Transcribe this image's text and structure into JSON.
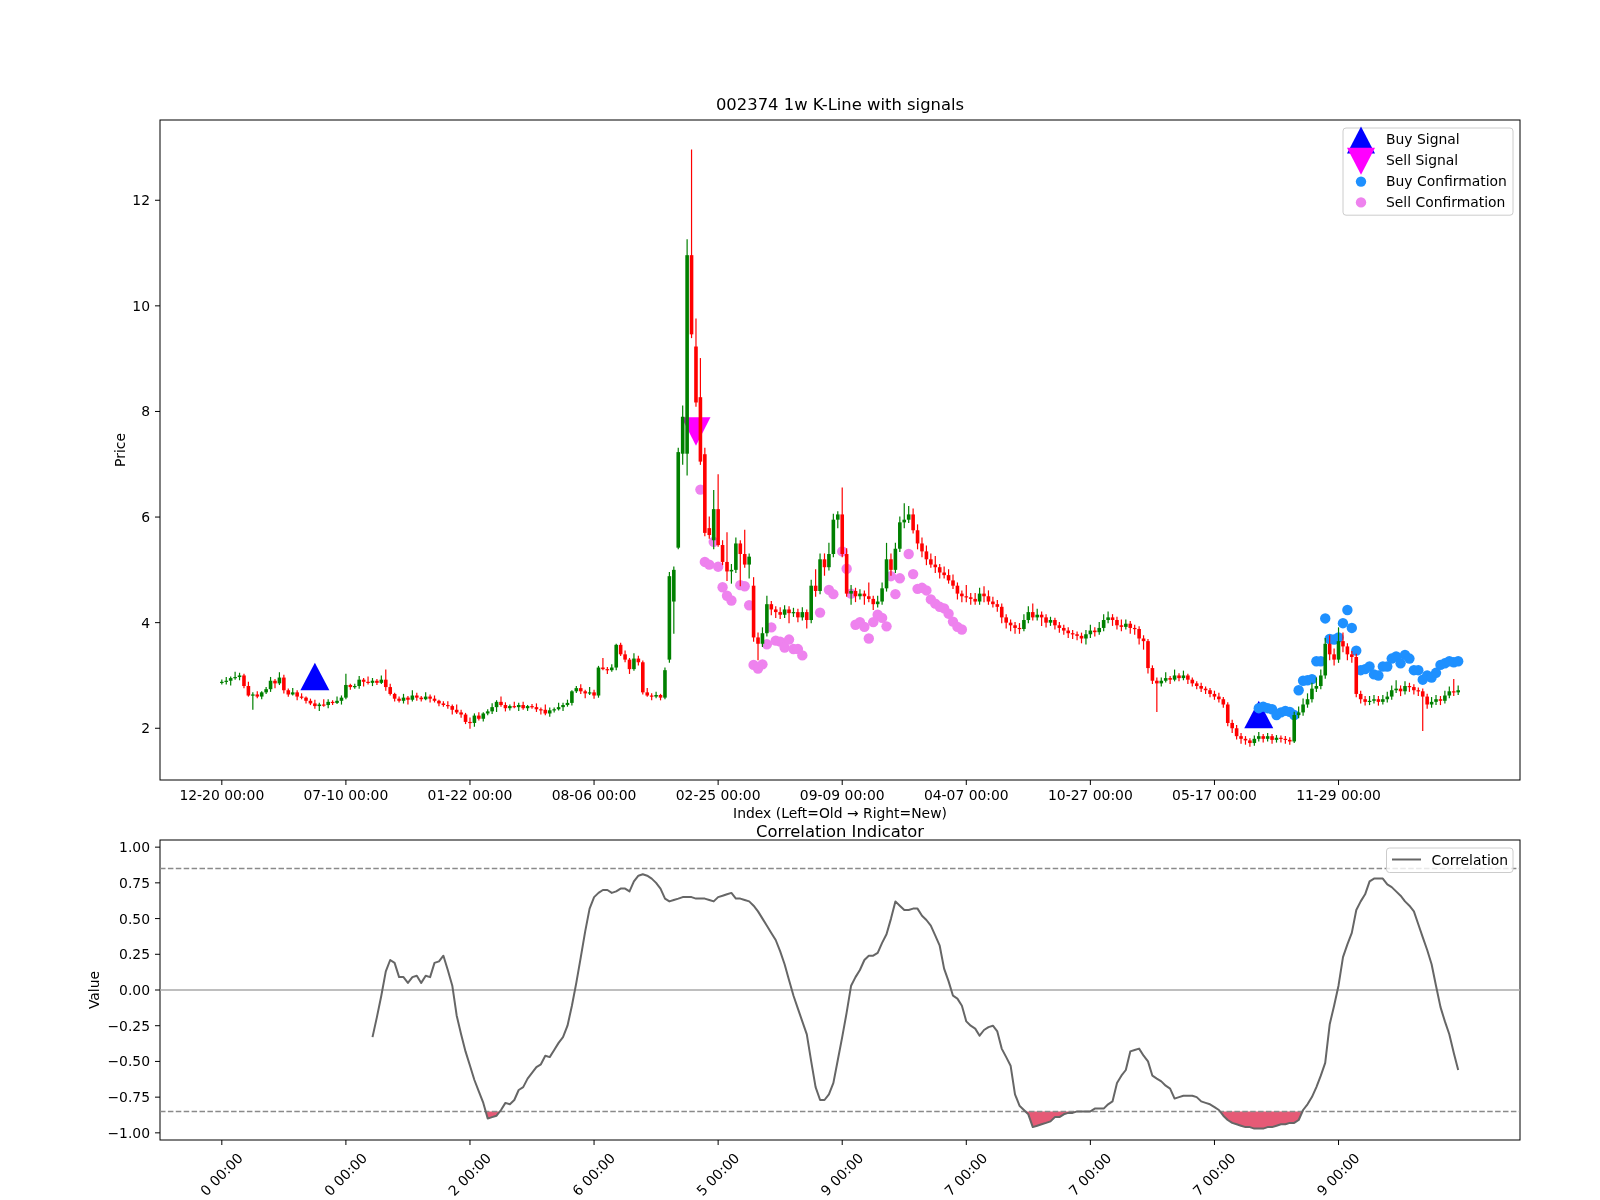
{
  "price_chart": {
    "chart_data": {
      "type": "candlestick",
      "title": "002374 1w K-Line with signals",
      "xlabel": "Index (Left=Old → Right=New)",
      "ylabel": "Price",
      "categories": [
        "12-20 00:00",
        null,
        null,
        null,
        null,
        null,
        null,
        null,
        null,
        null,
        null,
        null,
        null,
        null,
        null,
        null,
        null,
        null,
        null,
        null,
        null,
        null,
        null,
        null,
        null,
        null,
        null,
        null,
        "07-10 00:00",
        null,
        null,
        null,
        null,
        null,
        null,
        null,
        null,
        null,
        null,
        null,
        null,
        null,
        null,
        null,
        null,
        null,
        null,
        null,
        null,
        null,
        null,
        null,
        null,
        null,
        null,
        null,
        "01-22 00:00",
        null,
        null,
        null,
        null,
        null,
        null,
        null,
        null,
        null,
        null,
        null,
        null,
        null,
        null,
        null,
        null,
        null,
        null,
        null,
        null,
        null,
        null,
        null,
        null,
        null,
        null,
        null,
        "08-06 00:00",
        null,
        null,
        null,
        null,
        null,
        null,
        null,
        null,
        null,
        null,
        null,
        null,
        null,
        null,
        null,
        null,
        null,
        null,
        null,
        null,
        null,
        null,
        null,
        null,
        null,
        null,
        null,
        "02-25 00:00",
        null,
        null,
        null,
        null,
        null,
        null,
        null,
        null,
        null,
        null,
        null,
        null,
        null,
        null,
        null,
        null,
        null,
        null,
        null,
        null,
        null,
        null,
        null,
        null,
        null,
        null,
        null,
        "09-09 00:00",
        null,
        null,
        null,
        null,
        null,
        null,
        null,
        null,
        null,
        null,
        null,
        null,
        null,
        null,
        null,
        null,
        null,
        null,
        null,
        null,
        null,
        null,
        null,
        null,
        null,
        null,
        null,
        "04-07 00:00",
        null,
        null,
        null,
        null,
        null,
        null,
        null,
        null,
        null,
        null,
        null,
        null,
        null,
        null,
        null,
        null,
        null,
        null,
        null,
        null,
        null,
        null,
        null,
        null,
        null,
        null,
        null,
        "10-27 00:00",
        null,
        null,
        null,
        null,
        null,
        null,
        null,
        null,
        null,
        null,
        null,
        null,
        null,
        null,
        null,
        null,
        null,
        null,
        null,
        null,
        null,
        null,
        null,
        null,
        null,
        null,
        null,
        "05-17 00:00",
        null,
        null,
        null,
        null,
        null,
        null,
        null,
        null,
        null,
        null,
        null,
        null,
        null,
        null,
        null,
        null,
        null,
        null,
        null,
        null,
        null,
        null,
        null,
        null,
        null,
        null,
        null,
        "11-29 00:00",
        null,
        null,
        null,
        null,
        null,
        null,
        null,
        null,
        null,
        null,
        null,
        null,
        null,
        null,
        null,
        null,
        null,
        null,
        null,
        null,
        null,
        null,
        null,
        null,
        null,
        null,
        null
      ],
      "ohlc": [
        [
          2.86,
          2.91,
          2.84,
          2.88
        ],
        [
          2.88,
          2.96,
          2.84,
          2.9
        ],
        [
          2.9,
          2.97,
          2.82,
          2.95
        ],
        [
          2.95,
          3.06,
          2.93,
          2.97
        ],
        [
          2.97,
          3.04,
          2.92,
          3
        ],
        [
          3,
          3.02,
          2.77,
          2.8
        ],
        [
          2.8,
          2.87,
          2.61,
          2.62
        ],
        [
          2.62,
          2.67,
          2.36,
          2.64
        ],
        [
          2.64,
          2.69,
          2.58,
          2.6
        ],
        [
          2.6,
          2.69,
          2.56,
          2.68
        ],
        [
          2.68,
          2.77,
          2.66,
          2.74
        ],
        [
          2.74,
          2.96,
          2.7,
          2.9
        ],
        [
          2.9,
          2.92,
          2.77,
          2.85
        ],
        [
          2.85,
          3.05,
          2.83,
          2.96
        ],
        [
          2.96,
          3,
          2.67,
          2.72
        ],
        [
          2.72,
          2.74,
          2.61,
          2.64
        ],
        [
          2.64,
          2.75,
          2.63,
          2.68
        ],
        [
          2.68,
          2.71,
          2.54,
          2.6
        ],
        [
          2.6,
          2.65,
          2.56,
          2.58
        ],
        [
          2.58,
          2.59,
          2.48,
          2.52
        ],
        [
          2.52,
          2.55,
          2.45,
          2.47
        ],
        [
          2.47,
          2.53,
          2.38,
          2.42
        ],
        [
          2.42,
          2.47,
          2.34,
          2.45
        ],
        [
          2.45,
          2.54,
          2.42,
          2.44
        ],
        [
          2.44,
          2.54,
          2.39,
          2.5
        ],
        [
          2.5,
          2.52,
          2.45,
          2.48
        ],
        [
          2.48,
          2.59,
          2.47,
          2.52
        ],
        [
          2.52,
          2.61,
          2.46,
          2.58
        ],
        [
          2.58,
          3.02,
          2.56,
          2.82
        ],
        [
          2.82,
          2.83,
          2.74,
          2.78
        ],
        [
          2.78,
          2.83,
          2.76,
          2.8
        ],
        [
          2.8,
          2.98,
          2.76,
          2.92
        ],
        [
          2.92,
          2.94,
          2.8,
          2.88
        ],
        [
          2.88,
          2.97,
          2.84,
          2.86
        ],
        [
          2.86,
          2.94,
          2.81,
          2.9
        ],
        [
          2.9,
          2.92,
          2.83,
          2.86
        ],
        [
          2.86,
          2.99,
          2.85,
          2.92
        ],
        [
          2.92,
          3.1,
          2.72,
          2.78
        ],
        [
          2.78,
          2.83,
          2.63,
          2.65
        ],
        [
          2.65,
          2.66,
          2.52,
          2.56
        ],
        [
          2.56,
          2.59,
          2.5,
          2.52
        ],
        [
          2.52,
          2.64,
          2.48,
          2.58
        ],
        [
          2.58,
          2.6,
          2.46,
          2.54
        ],
        [
          2.54,
          2.71,
          2.52,
          2.62
        ],
        [
          2.62,
          2.66,
          2.53,
          2.58
        ],
        [
          2.58,
          2.6,
          2.52,
          2.55
        ],
        [
          2.55,
          2.67,
          2.54,
          2.6
        ],
        [
          2.6,
          2.63,
          2.5,
          2.56
        ],
        [
          2.56,
          2.61,
          2.5,
          2.52
        ],
        [
          2.52,
          2.53,
          2.43,
          2.47
        ],
        [
          2.47,
          2.5,
          2.42,
          2.44
        ],
        [
          2.44,
          2.5,
          2.38,
          2.42
        ],
        [
          2.42,
          2.44,
          2.27,
          2.35
        ],
        [
          2.35,
          2.44,
          2.28,
          2.3
        ],
        [
          2.3,
          2.34,
          2.21,
          2.26
        ],
        [
          2.26,
          2.28,
          2.09,
          2.12
        ],
        [
          2.12,
          2.19,
          2,
          2.1
        ],
        [
          2.1,
          2.27,
          2.04,
          2.24
        ],
        [
          2.24,
          2.29,
          2.16,
          2.18
        ],
        [
          2.18,
          2.29,
          2.14,
          2.28
        ],
        [
          2.28,
          2.35,
          2.26,
          2.32
        ],
        [
          2.32,
          2.46,
          2.28,
          2.4
        ],
        [
          2.4,
          2.52,
          2.32,
          2.5
        ],
        [
          2.5,
          2.59,
          2.42,
          2.44
        ],
        [
          2.44,
          2.48,
          2.33,
          2.38
        ],
        [
          2.38,
          2.44,
          2.35,
          2.42
        ],
        [
          2.42,
          2.49,
          2.39,
          2.4
        ],
        [
          2.4,
          2.47,
          2.34,
          2.44
        ],
        [
          2.44,
          2.49,
          2.36,
          2.38
        ],
        [
          2.38,
          2.43,
          2.34,
          2.42
        ],
        [
          2.42,
          2.45,
          2.38,
          2.4
        ],
        [
          2.4,
          2.46,
          2.32,
          2.36
        ],
        [
          2.36,
          2.38,
          2.27,
          2.35
        ],
        [
          2.35,
          2.44,
          2.26,
          2.28
        ],
        [
          2.28,
          2.38,
          2.23,
          2.34
        ],
        [
          2.34,
          2.38,
          2.31,
          2.36
        ],
        [
          2.36,
          2.47,
          2.35,
          2.4
        ],
        [
          2.4,
          2.47,
          2.34,
          2.44
        ],
        [
          2.44,
          2.53,
          2.42,
          2.48
        ],
        [
          2.48,
          2.71,
          2.44,
          2.7
        ],
        [
          2.7,
          2.79,
          2.68,
          2.76
        ],
        [
          2.76,
          2.82,
          2.66,
          2.7
        ],
        [
          2.7,
          2.72,
          2.58,
          2.66
        ],
        [
          2.66,
          2.77,
          2.64,
          2.68
        ],
        [
          2.68,
          2.72,
          2.57,
          2.62
        ],
        [
          2.62,
          3.17,
          2.59,
          3.15
        ],
        [
          3.15,
          3.32,
          3.11,
          3.12
        ],
        [
          3.12,
          3.15,
          3.04,
          3.1
        ],
        [
          3.1,
          3.2,
          3.08,
          3.15
        ],
        [
          3.15,
          3.59,
          3.11,
          3.58
        ],
        [
          3.58,
          3.61,
          3.38,
          3.4
        ],
        [
          3.4,
          3.46,
          3.26,
          3.3
        ],
        [
          3.3,
          3.32,
          3.04,
          3.12
        ],
        [
          3.12,
          3.41,
          3.1,
          3.32
        ],
        [
          3.32,
          3.36,
          3.2,
          3.25
        ],
        [
          3.25,
          3.27,
          2.65,
          2.68
        ],
        [
          2.68,
          2.75,
          2.61,
          2.62
        ],
        [
          2.62,
          2.65,
          2.54,
          2.6
        ],
        [
          2.6,
          2.68,
          2.58,
          2.63
        ],
        [
          2.63,
          2.64,
          2.54,
          2.58
        ],
        [
          2.58,
          3.14,
          2.56,
          3.1
        ],
        [
          3.3,
          4.95,
          3.25,
          4.88
        ],
        [
          4.4,
          5.05,
          3.8,
          5
        ],
        [
          5.42,
          7.3,
          5.4,
          7.23
        ],
        [
          7.2,
          8.1,
          7,
          7.9
        ],
        [
          7.2,
          11.25,
          6.8,
          10.96
        ],
        [
          10.96,
          12.95,
          9.4,
          9.46
        ],
        [
          9.23,
          9.75,
          8.1,
          8.17
        ],
        [
          8.27,
          9,
          7,
          7.05
        ],
        [
          7.19,
          7.3,
          5.65,
          5.7
        ],
        [
          5.79,
          6,
          5.6,
          5.66
        ],
        [
          5.56,
          6.5,
          5.4,
          6.15
        ],
        [
          6.15,
          6.8,
          5.45,
          5.47
        ],
        [
          5.47,
          5.55,
          5.1,
          5.15
        ],
        [
          5.15,
          5.7,
          4.8,
          4.97
        ],
        [
          4.97,
          5.1,
          4.75,
          5
        ],
        [
          5,
          5.6,
          4.95,
          5.5
        ],
        [
          5.5,
          5.55,
          4.7,
          5.3
        ],
        [
          5.3,
          5.75,
          5.05,
          5.1
        ],
        [
          5.1,
          5.3,
          4.85,
          5.25
        ],
        [
          4.7,
          4.85,
          3.65,
          3.72
        ],
        [
          3.72,
          3.8,
          3.3,
          3.6
        ],
        [
          3.6,
          3.9,
          3.55,
          3.8
        ],
        [
          3.8,
          4.5,
          3.75,
          4.35
        ],
        [
          4.35,
          4.4,
          4.15,
          4.25
        ],
        [
          4.25,
          4.3,
          4.1,
          4.2
        ],
        [
          4.2,
          4.28,
          4.08,
          4.15
        ],
        [
          4.15,
          4.32,
          4.1,
          4.25
        ],
        [
          4.25,
          4.3,
          4,
          4.18
        ],
        [
          4.18,
          4.27,
          4.12,
          4.2
        ],
        [
          4.2,
          4.25,
          4.02,
          4.1
        ],
        [
          4.1,
          4.28,
          4.05,
          4.2
        ],
        [
          4.2,
          4.24,
          3.9,
          4.05
        ],
        [
          4.05,
          4.8,
          4,
          4.7
        ],
        [
          4.7,
          5,
          4.5,
          4.6
        ],
        [
          4.6,
          5.3,
          4.55,
          5.2
        ],
        [
          5.2,
          5.3,
          4.9,
          5.05
        ],
        [
          5.05,
          5.5,
          5,
          5.3
        ],
        [
          5.3,
          6.05,
          5.25,
          5.95
        ],
        [
          5.95,
          6.1,
          5.8,
          6.05
        ],
        [
          6.05,
          6.55,
          5.25,
          5.3
        ],
        [
          5.3,
          5.4,
          4.5,
          4.55
        ],
        [
          4.55,
          4.7,
          4.35,
          4.6
        ],
        [
          4.6,
          4.65,
          4.4,
          4.5
        ],
        [
          4.5,
          4.62,
          4.45,
          4.55
        ],
        [
          4.55,
          4.6,
          4.35,
          4.5
        ],
        [
          4.5,
          4.75,
          4.4,
          4.45
        ],
        [
          4.45,
          4.5,
          4.25,
          4.35
        ],
        [
          4.35,
          4.5,
          4.3,
          4.4
        ],
        [
          4.4,
          4.75,
          4.35,
          4.65
        ],
        [
          4.65,
          5.5,
          4.6,
          5.2
        ],
        [
          5.2,
          5.3,
          4.9,
          5
        ],
        [
          5,
          5.5,
          4.95,
          5.4
        ],
        [
          5.4,
          6,
          5.35,
          5.9
        ],
        [
          5.9,
          6.25,
          5.8,
          5.95
        ],
        [
          5.95,
          6.2,
          5.9,
          6.05
        ],
        [
          6.05,
          6.15,
          5.7,
          5.75
        ],
        [
          5.75,
          5.85,
          5.4,
          5.5
        ],
        [
          5.5,
          5.6,
          5.25,
          5.35
        ],
        [
          5.35,
          5.45,
          5.1,
          5.2
        ],
        [
          5.2,
          5.3,
          5.05,
          5.1
        ],
        [
          5.1,
          5.25,
          4.95,
          5.05
        ],
        [
          5.05,
          5.1,
          4.85,
          4.95
        ],
        [
          4.95,
          5.05,
          4.85,
          4.9
        ],
        [
          4.9,
          5,
          4.75,
          4.8
        ],
        [
          4.8,
          4.9,
          4.65,
          4.7
        ],
        [
          4.7,
          4.75,
          4.45,
          4.55
        ],
        [
          4.55,
          4.6,
          4.4,
          4.5
        ],
        [
          4.5,
          4.7,
          4.4,
          4.48
        ],
        [
          4.48,
          4.55,
          4.35,
          4.45
        ],
        [
          4.45,
          4.55,
          4.35,
          4.4
        ],
        [
          4.4,
          4.65,
          4.35,
          4.55
        ],
        [
          4.55,
          4.68,
          4.4,
          4.5
        ],
        [
          4.5,
          4.6,
          4.35,
          4.4
        ],
        [
          4.4,
          4.48,
          4.3,
          4.35
        ],
        [
          4.35,
          4.42,
          4.22,
          4.3
        ],
        [
          4.3,
          4.35,
          4,
          4.1
        ],
        [
          4.1,
          4.15,
          3.9,
          4
        ],
        [
          4,
          4.05,
          3.85,
          3.95
        ],
        [
          3.95,
          4,
          3.8,
          3.9
        ],
        [
          3.9,
          3.98,
          3.8,
          3.88
        ],
        [
          3.88,
          4.15,
          3.85,
          4.05
        ],
        [
          4.05,
          4.3,
          4,
          4.2
        ],
        [
          4.2,
          4.35,
          4.05,
          4.1
        ],
        [
          4.1,
          4.25,
          4.05,
          4.15
        ],
        [
          4.15,
          4.2,
          3.95,
          4.1
        ],
        [
          4.1,
          4.15,
          3.92,
          4
        ],
        [
          4,
          4.1,
          3.95,
          4.05
        ],
        [
          4.05,
          4.08,
          3.88,
          3.95
        ],
        [
          3.95,
          4,
          3.82,
          3.9
        ],
        [
          3.9,
          3.95,
          3.78,
          3.85
        ],
        [
          3.85,
          3.9,
          3.72,
          3.8
        ],
        [
          3.8,
          3.85,
          3.7,
          3.78
        ],
        [
          3.78,
          3.82,
          3.68,
          3.75
        ],
        [
          3.75,
          3.8,
          3.62,
          3.7
        ],
        [
          3.7,
          3.85,
          3.6,
          3.78
        ],
        [
          3.78,
          3.95,
          3.72,
          3.85
        ],
        [
          3.85,
          3.9,
          3.75,
          3.82
        ],
        [
          3.82,
          4,
          3.78,
          3.9
        ],
        [
          3.9,
          4.15,
          3.85,
          4.05
        ],
        [
          4.05,
          4.2,
          4,
          4.1
        ],
        [
          4.1,
          4.15,
          3.95,
          4.05
        ],
        [
          4.05,
          4.1,
          3.88,
          3.95
        ],
        [
          3.95,
          4.05,
          3.85,
          3.92
        ],
        [
          3.92,
          4.05,
          3.88,
          3.98
        ],
        [
          3.98,
          4.02,
          3.8,
          3.9
        ],
        [
          3.9,
          3.95,
          3.78,
          3.88
        ],
        [
          3.88,
          3.92,
          3.6,
          3.7
        ],
        [
          3.7,
          3.75,
          3.5,
          3.65
        ],
        [
          3.65,
          3.68,
          3.05,
          3.14
        ],
        [
          3.14,
          3.18,
          2.85,
          2.9
        ],
        [
          2.9,
          2.95,
          2.32,
          2.85
        ],
        [
          2.85,
          2.95,
          2.8,
          2.9
        ],
        [
          2.9,
          3.05,
          2.88,
          2.95
        ],
        [
          2.95,
          2.98,
          2.85,
          2.92
        ],
        [
          2.92,
          3.1,
          2.9,
          3
        ],
        [
          3,
          3.03,
          2.9,
          2.95
        ],
        [
          2.95,
          3.08,
          2.92,
          3
        ],
        [
          3,
          3.02,
          2.85,
          2.92
        ],
        [
          2.92,
          2.95,
          2.8,
          2.85
        ],
        [
          2.85,
          2.88,
          2.75,
          2.8
        ],
        [
          2.8,
          2.85,
          2.7,
          2.75
        ],
        [
          2.75,
          2.78,
          2.66,
          2.72
        ],
        [
          2.72,
          2.75,
          2.6,
          2.65
        ],
        [
          2.65,
          2.7,
          2.55,
          2.6
        ],
        [
          2.6,
          2.66,
          2.5,
          2.55
        ],
        [
          2.55,
          2.58,
          2.4,
          2.45
        ],
        [
          2.45,
          2.48,
          2.05,
          2.1
        ],
        [
          2.1,
          2.15,
          1.92,
          2
        ],
        [
          2,
          2.05,
          1.8,
          1.85
        ],
        [
          1.85,
          1.9,
          1.72,
          1.8
        ],
        [
          1.8,
          1.84,
          1.7,
          1.77
        ],
        [
          1.77,
          1.8,
          1.66,
          1.72
        ],
        [
          1.72,
          1.85,
          1.68,
          1.8
        ],
        [
          1.8,
          1.92,
          1.76,
          1.85
        ],
        [
          1.85,
          1.88,
          1.74,
          1.8
        ],
        [
          1.8,
          1.9,
          1.76,
          1.85
        ],
        [
          1.85,
          1.88,
          1.72,
          1.78
        ],
        [
          1.78,
          1.86,
          1.74,
          1.82
        ],
        [
          1.82,
          1.85,
          1.74,
          1.8
        ],
        [
          1.8,
          1.84,
          1.72,
          1.78
        ],
        [
          1.78,
          1.82,
          1.7,
          1.75
        ],
        [
          1.75,
          2.3,
          1.73,
          2.25
        ],
        [
          2.25,
          2.4,
          2.2,
          2.3
        ],
        [
          2.3,
          2.55,
          2.25,
          2.45
        ],
        [
          2.45,
          2.65,
          2.4,
          2.55
        ],
        [
          2.55,
          2.85,
          2.5,
          2.75
        ],
        [
          2.75,
          2.95,
          2.7,
          2.8
        ],
        [
          2.8,
          3.1,
          2.75,
          3
        ],
        [
          3,
          3.7,
          2.95,
          3.6
        ],
        [
          3.6,
          3.75,
          3.3,
          3.4
        ],
        [
          3.4,
          3.5,
          3.2,
          3.3
        ],
        [
          3.3,
          3.9,
          3.25,
          3.65
        ],
        [
          3.65,
          3.8,
          3.45,
          3.55
        ],
        [
          3.55,
          3.6,
          3.3,
          3.4
        ],
        [
          3.4,
          3.45,
          3.25,
          3.35
        ],
        [
          3.35,
          3.4,
          2.6,
          2.65
        ],
        [
          2.65,
          2.7,
          2.48,
          2.55
        ],
        [
          2.55,
          2.6,
          2.44,
          2.5
        ],
        [
          2.5,
          2.6,
          2.45,
          2.52
        ],
        [
          2.52,
          2.62,
          2.48,
          2.55
        ],
        [
          2.55,
          2.6,
          2.44,
          2.5
        ],
        [
          2.5,
          2.62,
          2.46,
          2.55
        ],
        [
          2.55,
          2.68,
          2.5,
          2.6
        ],
        [
          2.6,
          2.8,
          2.55,
          2.72
        ],
        [
          2.72,
          2.9,
          2.68,
          2.75
        ],
        [
          2.75,
          2.8,
          2.62,
          2.7
        ],
        [
          2.7,
          2.88,
          2.65,
          2.8
        ],
        [
          2.8,
          2.85,
          2.7,
          2.78
        ],
        [
          2.78,
          2.82,
          2.65,
          2.72
        ],
        [
          2.72,
          2.76,
          2.62,
          2.7
        ],
        [
          2.7,
          2.74,
          1.96,
          2.6
        ],
        [
          2.6,
          2.64,
          2.38,
          2.45
        ],
        [
          2.45,
          2.58,
          2.4,
          2.5
        ],
        [
          2.5,
          2.62,
          2.45,
          2.55
        ],
        [
          2.55,
          2.6,
          2.45,
          2.52
        ],
        [
          2.52,
          2.7,
          2.48,
          2.62
        ],
        [
          2.62,
          2.78,
          2.58,
          2.7
        ],
        [
          2.7,
          2.92,
          2.62,
          2.68
        ],
        [
          2.68,
          2.8,
          2.64,
          2.72
        ]
      ],
      "ylim": [
        1.02,
        13.52
      ],
      "yticks": [
        {
          "value": 2,
          "label": "2"
        },
        {
          "value": 4,
          "label": "4"
        },
        {
          "value": 6,
          "label": "6"
        },
        {
          "value": 8,
          "label": "8"
        },
        {
          "value": 10,
          "label": "10"
        },
        {
          "value": 12,
          "label": "12"
        }
      ]
    },
    "legend": [
      {
        "label": "Buy Signal",
        "kind": "up-triangle",
        "color": "#0000ff"
      },
      {
        "label": "Sell Signal",
        "kind": "down-triangle",
        "color": "#ff00ff"
      },
      {
        "label": "Buy Confirmation",
        "kind": "dot",
        "color": "#1e90ff"
      },
      {
        "label": "Sell Confirmation",
        "kind": "dot",
        "color": "#ee82ee"
      }
    ]
  },
  "correlation_chart": {
    "chart_data": {
      "type": "line",
      "title": "Correlation Indicator",
      "ylabel": "Value",
      "categories": [
        "0 00:00",
        null,
        null,
        null,
        null,
        null,
        null,
        null,
        null,
        null,
        null,
        null,
        null,
        null,
        null,
        null,
        null,
        null,
        null,
        null,
        null,
        null,
        null,
        null,
        null,
        null,
        null,
        null,
        "0 00:00",
        null,
        null,
        null,
        null,
        null,
        null,
        null,
        null,
        null,
        null,
        null,
        null,
        null,
        null,
        null,
        null,
        null,
        null,
        null,
        null,
        null,
        null,
        null,
        null,
        null,
        null,
        null,
        "2 00:00",
        null,
        null,
        null,
        null,
        null,
        null,
        null,
        null,
        null,
        null,
        null,
        null,
        null,
        null,
        null,
        null,
        null,
        null,
        null,
        null,
        null,
        null,
        null,
        null,
        null,
        null,
        null,
        "6 00:00",
        null,
        null,
        null,
        null,
        null,
        null,
        null,
        null,
        null,
        null,
        null,
        null,
        null,
        null,
        null,
        null,
        null,
        null,
        null,
        null,
        null,
        null,
        null,
        null,
        null,
        null,
        null,
        "5 00:00",
        null,
        null,
        null,
        null,
        null,
        null,
        null,
        null,
        null,
        null,
        null,
        null,
        null,
        null,
        null,
        null,
        null,
        null,
        null,
        null,
        null,
        null,
        null,
        null,
        null,
        null,
        null,
        "9 00:00",
        null,
        null,
        null,
        null,
        null,
        null,
        null,
        null,
        null,
        null,
        null,
        null,
        null,
        null,
        null,
        null,
        null,
        null,
        null,
        null,
        null,
        null,
        null,
        null,
        null,
        null,
        null,
        "7 00:00",
        null,
        null,
        null,
        null,
        null,
        null,
        null,
        null,
        null,
        null,
        null,
        null,
        null,
        null,
        null,
        null,
        null,
        null,
        null,
        null,
        null,
        null,
        null,
        null,
        null,
        null,
        null,
        "7 00:00",
        null,
        null,
        null,
        null,
        null,
        null,
        null,
        null,
        null,
        null,
        null,
        null,
        null,
        null,
        null,
        null,
        null,
        null,
        null,
        null,
        null,
        null,
        null,
        null,
        null,
        null,
        null,
        "7 00:00",
        null,
        null,
        null,
        null,
        null,
        null,
        null,
        null,
        null,
        null,
        null,
        null,
        null,
        null,
        null,
        null,
        null,
        null,
        null,
        null,
        null,
        null,
        null,
        null,
        null,
        null,
        null,
        "9 00:00",
        null,
        null,
        null,
        null,
        null,
        null,
        null,
        null,
        null,
        null,
        null,
        null,
        null,
        null,
        null,
        null,
        null,
        null,
        null,
        null,
        null,
        null,
        null,
        null,
        null,
        null,
        null
      ],
      "series": [
        {
          "name": "Correlation",
          "color": "#666666",
          "values": [
            null,
            null,
            null,
            null,
            null,
            null,
            null,
            null,
            null,
            null,
            null,
            null,
            null,
            null,
            null,
            null,
            null,
            null,
            null,
            null,
            null,
            null,
            null,
            null,
            null,
            null,
            null,
            null,
            null,
            null,
            null,
            null,
            null,
            null,
            -0.33,
            -0.19,
            -0.04,
            0.13,
            0.21,
            0.19,
            0.09,
            0.09,
            0.05,
            0.09,
            0.1,
            0.05,
            0.1,
            0.09,
            0.19,
            0.2,
            0.24,
            0.14,
            0.03,
            -0.18,
            -0.31,
            -0.43,
            -0.53,
            -0.63,
            -0.71,
            -0.79,
            -0.9,
            -0.89,
            -0.88,
            -0.84,
            -0.79,
            -0.8,
            -0.77,
            -0.7,
            -0.68,
            -0.62,
            -0.58,
            -0.54,
            -0.52,
            -0.46,
            -0.47,
            -0.42,
            -0.37,
            -0.33,
            -0.25,
            -0.11,
            0.05,
            0.23,
            0.41,
            0.57,
            0.65,
            0.68,
            0.7,
            0.7,
            0.68,
            0.69,
            0.71,
            0.71,
            0.69,
            0.76,
            0.8,
            0.81,
            0.8,
            0.78,
            0.75,
            0.71,
            0.64,
            0.62,
            0.63,
            0.64,
            0.65,
            0.65,
            0.65,
            0.64,
            0.64,
            0.64,
            0.63,
            0.62,
            0.65,
            0.66,
            0.67,
            0.68,
            0.64,
            0.64,
            0.63,
            0.62,
            0.59,
            0.55,
            0.5,
            0.45,
            0.4,
            0.35,
            0.27,
            0.18,
            0.07,
            -0.04,
            -0.13,
            -0.22,
            -0.31,
            -0.5,
            -0.68,
            -0.77,
            -0.77,
            -0.73,
            -0.65,
            -0.49,
            -0.33,
            -0.16,
            0.03,
            0.09,
            0.14,
            0.21,
            0.24,
            0.24,
            0.26,
            0.33,
            0.39,
            0.5,
            0.62,
            0.59,
            0.56,
            0.56,
            0.57,
            0.57,
            0.52,
            0.49,
            0.45,
            0.38,
            0.31,
            0.15,
            0.06,
            -0.04,
            -0.06,
            -0.11,
            -0.22,
            -0.25,
            -0.27,
            -0.32,
            -0.28,
            -0.26,
            -0.25,
            -0.29,
            -0.41,
            -0.47,
            -0.53,
            -0.73,
            -0.81,
            -0.84,
            -0.87,
            -0.96,
            -0.95,
            -0.94,
            -0.93,
            -0.92,
            -0.89,
            -0.89,
            -0.87,
            -0.86,
            -0.86,
            -0.85,
            -0.85,
            -0.85,
            -0.85,
            -0.83,
            -0.83,
            -0.83,
            -0.8,
            -0.78,
            -0.65,
            -0.6,
            -0.56,
            -0.43,
            -0.42,
            -0.41,
            -0.46,
            -0.5,
            -0.6,
            -0.62,
            -0.64,
            -0.67,
            -0.69,
            -0.76,
            -0.75,
            -0.74,
            -0.74,
            -0.74,
            -0.75,
            -0.78,
            -0.79,
            -0.8,
            -0.82,
            -0.84,
            -0.88,
            -0.91,
            -0.93,
            -0.94,
            -0.95,
            -0.96,
            -0.96,
            -0.97,
            -0.97,
            -0.97,
            -0.96,
            -0.96,
            -0.95,
            -0.94,
            -0.94,
            -0.93,
            -0.93,
            -0.91,
            -0.84,
            -0.8,
            -0.75,
            -0.68,
            -0.6,
            -0.51,
            -0.24,
            -0.11,
            0.03,
            0.23,
            0.32,
            0.4,
            0.56,
            0.62,
            0.67,
            0.76,
            0.78,
            0.78,
            0.78,
            0.74,
            0.72,
            0.69,
            0.66,
            0.62,
            0.59,
            0.55,
            0.46,
            0.37,
            0.28,
            0.18,
            0.03,
            -0.12,
            -0.22,
            -0.31,
            -0.44,
            -0.56
          ]
        }
      ],
      "ylim": [
        -1.05,
        1.05
      ],
      "yticks": [
        {
          "value": -1,
          "label": "−1.00"
        },
        {
          "value": -0.75,
          "label": "−0.75"
        },
        {
          "value": -0.5,
          "label": "−0.50"
        },
        {
          "value": -0.25,
          "label": "−0.25"
        },
        {
          "value": 0,
          "label": "0.00"
        },
        {
          "value": 0.25,
          "label": "0.25"
        },
        {
          "value": 0.5,
          "label": "0.50"
        },
        {
          "value": 0.75,
          "label": "0.75"
        },
        {
          "value": 1,
          "label": "1.00"
        }
      ],
      "ref_lines": [
        {
          "axis": "y",
          "value": 0.85
        },
        {
          "axis": "y",
          "value": -0.85
        },
        {
          "axis": "y",
          "value": 0
        }
      ]
    }
  }
}
